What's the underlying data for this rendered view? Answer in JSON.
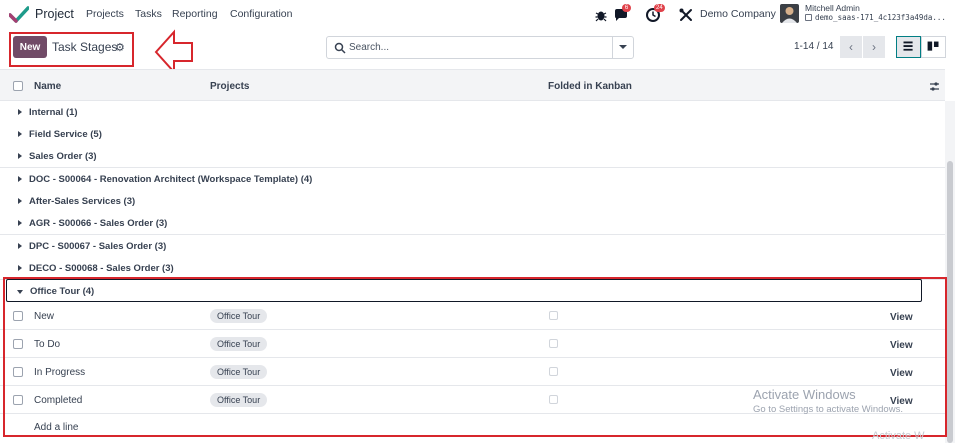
{
  "navbar": {
    "app_name": "Project",
    "menu": [
      "Projects",
      "Tasks",
      "Reporting",
      "Configuration"
    ],
    "messages_badge": "6",
    "activities_badge": "24",
    "company": "Demo Company",
    "user_name": "Mitchell Admin",
    "database": "demo_saas-171_4c123f3a49da..."
  },
  "control": {
    "new_label": "New",
    "breadcrumb": "Task Stages",
    "search_placeholder": "Search...",
    "pager": "1-14 / 14"
  },
  "table": {
    "headers": {
      "name": "Name",
      "projects": "Projects",
      "folded": "Folded in Kanban"
    },
    "groups": [
      "Internal (1)",
      "Field Service (5)",
      "Sales Order (3)",
      "DOC - S00064 - Renovation Architect (Workspace Template) (4)",
      "After-Sales Services (3)",
      "AGR - S00066 - Sales Order (3)",
      "DPC - S00067 - Sales Order (3)",
      "DECO - S00068 - Sales Order (3)",
      "Office Tour (4)"
    ],
    "records": [
      {
        "name": "New",
        "project": "Office Tour",
        "action": "View"
      },
      {
        "name": "To Do",
        "project": "Office Tour",
        "action": "View"
      },
      {
        "name": "In Progress",
        "project": "Office Tour",
        "action": "View"
      },
      {
        "name": "Completed",
        "project": "Office Tour",
        "action": "View"
      }
    ],
    "add_line": "Add a line"
  },
  "watermark": {
    "title": "Activate Windows",
    "subtitle": "Go to Settings to activate Windows.",
    "edge": "Activate W"
  },
  "colors": {
    "brand": "#714b67",
    "annotation": "#d7262c",
    "accent": "#017e84"
  }
}
